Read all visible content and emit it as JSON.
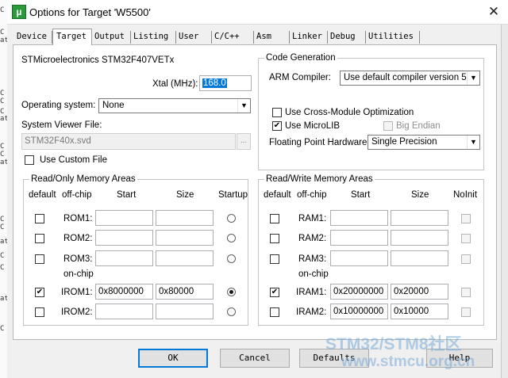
{
  "window": {
    "title": "Options for Target 'W5500'",
    "app_icon": "µ",
    "close_glyph": "✕"
  },
  "edge_text": [
    "C",
    "C",
    "at",
    "C",
    "C",
    "C",
    "at",
    "C",
    "C",
    "at",
    "C",
    "C",
    "at",
    "C",
    "C",
    "at",
    "C"
  ],
  "tabs": [
    {
      "label": "Device",
      "active": false
    },
    {
      "label": "Target",
      "active": true
    },
    {
      "label": "Output",
      "active": false
    },
    {
      "label": "Listing",
      "active": false
    },
    {
      "label": "User",
      "active": false
    },
    {
      "label": "C/C++",
      "active": false
    },
    {
      "label": "Asm",
      "active": false
    },
    {
      "label": "Linker",
      "active": false
    },
    {
      "label": "Debug",
      "active": false
    },
    {
      "label": "Utilities",
      "active": false
    }
  ],
  "target": {
    "device_name": "STMicroelectronics STM32F407VETx",
    "xtal_label": "Xtal (MHz):",
    "xtal_value": "168.0",
    "os_label": "Operating system:",
    "os_value": "None",
    "svd_label": "System Viewer File:",
    "svd_value": "STM32F40x.svd",
    "browse_label": "...",
    "custom_file_label": "Use Custom File",
    "custom_file_checked": false
  },
  "code_generation": {
    "title": "Code Generation",
    "compiler_label": "ARM Compiler:",
    "compiler_value": "Use default compiler version 5",
    "cross_module_label": "Use Cross-Module Optimization",
    "cross_module_checked": false,
    "microlib_label": "Use MicroLIB",
    "microlib_checked": true,
    "big_endian_label": "Big Endian",
    "big_endian_checked": false,
    "fpu_label": "Floating Point Hardware:",
    "fpu_value": "Single Precision"
  },
  "ro_memory": {
    "title": "Read/Only Memory Areas",
    "headers": {
      "default": "default",
      "offchip": "off-chip",
      "start": "Start",
      "size": "Size",
      "last": "Startup"
    },
    "onchip_label": "on-chip",
    "rows": [
      {
        "name": "ROM1:",
        "checked": false,
        "start": "",
        "size": "",
        "selected": false
      },
      {
        "name": "ROM2:",
        "checked": false,
        "start": "",
        "size": "",
        "selected": false
      },
      {
        "name": "ROM3:",
        "checked": false,
        "start": "",
        "size": "",
        "selected": false
      },
      {
        "name": "IROM1:",
        "checked": true,
        "start": "0x8000000",
        "size": "0x80000",
        "selected": true
      },
      {
        "name": "IROM2:",
        "checked": false,
        "start": "",
        "size": "",
        "selected": false
      }
    ]
  },
  "rw_memory": {
    "title": "Read/Write Memory Areas",
    "headers": {
      "default": "default",
      "offchip": "off-chip",
      "start": "Start",
      "size": "Size",
      "last": "NoInit"
    },
    "onchip_label": "on-chip",
    "rows": [
      {
        "name": "RAM1:",
        "checked": false,
        "start": "",
        "size": "",
        "noinit": false
      },
      {
        "name": "RAM2:",
        "checked": false,
        "start": "",
        "size": "",
        "noinit": false
      },
      {
        "name": "RAM3:",
        "checked": false,
        "start": "",
        "size": "",
        "noinit": false
      },
      {
        "name": "IRAM1:",
        "checked": true,
        "start": "0x20000000",
        "size": "0x20000",
        "noinit": false
      },
      {
        "name": "IRAM2:",
        "checked": false,
        "start": "0x10000000",
        "size": "0x10000",
        "noinit": false
      }
    ]
  },
  "buttons": {
    "ok": "OK",
    "cancel": "Cancel",
    "defaults": "Defaults",
    "help": "Help"
  },
  "watermark": {
    "line1": "STM32/STM8社区",
    "line2": "www.stmcu.org.cn"
  },
  "colors": {
    "selection": "#0078d7",
    "dialog_bg": "#f0f0f0",
    "watermark": "#78aad7"
  }
}
